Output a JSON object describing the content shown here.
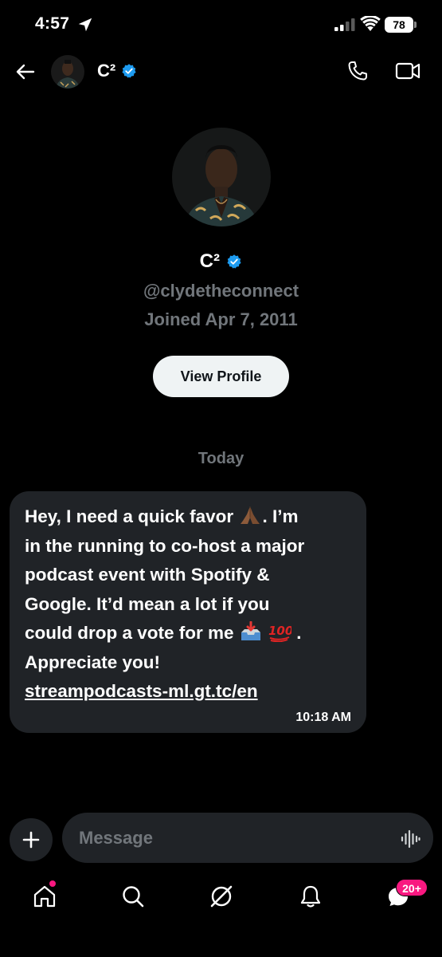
{
  "status_bar": {
    "time": "4:57",
    "battery": "78",
    "location_icon": "location-arrow-icon",
    "signal_icon": "signal-icon",
    "wifi_icon": "wifi-icon"
  },
  "header": {
    "name": "C²",
    "verified_icon": "verified-badge-icon",
    "back_icon": "back-arrow-icon",
    "call_icon": "phone-icon",
    "video_icon": "video-camera-icon"
  },
  "profile": {
    "name": "C²",
    "handle": "@clydetheconnect",
    "joined": "Joined Apr 7, 2011",
    "view_profile_label": "View Profile"
  },
  "conversation": {
    "day_label": "Today",
    "messages": [
      {
        "text_part1": "Hey, I need a quick favor ",
        "emoji1": "🙏🏾",
        "text_part2": ". I’m\nin the running to co-host a major\npodcast event with Spotify &\nGoogle. It’d mean a lot if you\ncould drop a vote for me ",
        "emoji2": "📥",
        "emoji3": "💯",
        "text_part3": " .\nAppreciate you!",
        "link": "streampodcasts-ml.gt.tc/en",
        "time": "10:18 AM"
      }
    ]
  },
  "composer": {
    "placeholder": "Message",
    "add_icon": "plus-icon",
    "voice_icon": "voice-waveform-icon"
  },
  "bottom_nav": {
    "items": [
      "home-icon",
      "search-icon",
      "grok-icon",
      "notifications-icon",
      "messages-icon"
    ],
    "messages_badge": "20+"
  },
  "colors": {
    "background": "#000000",
    "bubble": "#202327",
    "muted_text": "#71767b",
    "verified_blue": "#1d9bf0",
    "badge_pink": "#f91880",
    "button_light": "#eff3f4"
  }
}
